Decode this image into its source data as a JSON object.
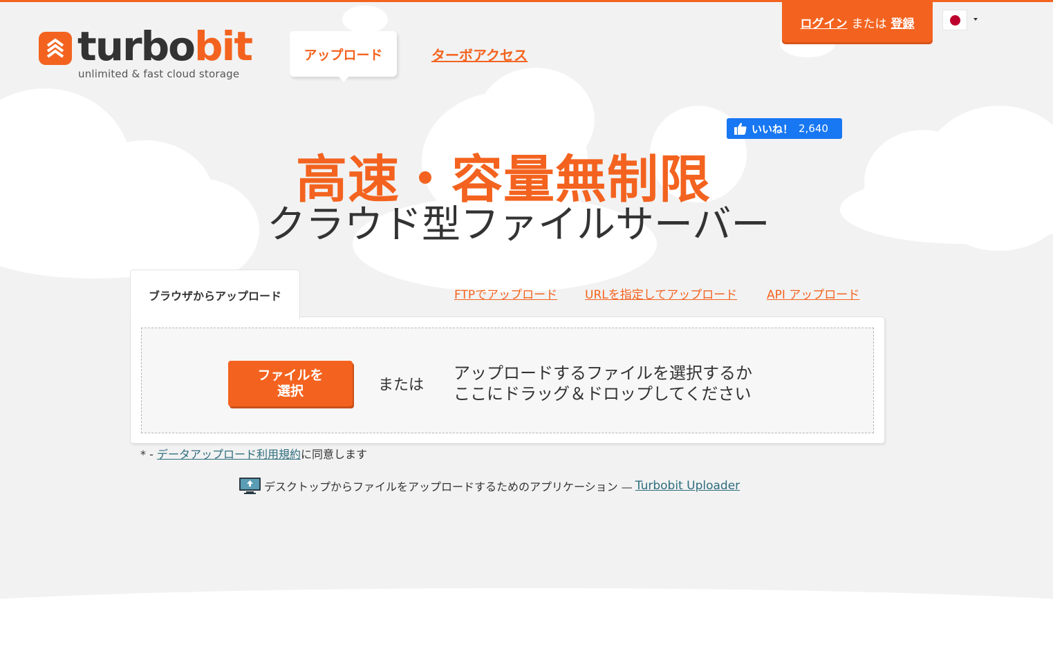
{
  "brand": {
    "name_part1": "turbo",
    "name_part2": "bit",
    "tagline": "unlimited & fast cloud storage",
    "accent_color": "#f3631f"
  },
  "nav": {
    "upload_label": "アップロード",
    "turbo_access_label": "ターボアクセス"
  },
  "auth": {
    "login_label": "ログイン",
    "or_label": "または",
    "register_label": "登録"
  },
  "language": {
    "current": "Japanese flag",
    "icon": "flag-japan-icon"
  },
  "facebook": {
    "like_label": "いいね！",
    "like_count": "2,640"
  },
  "hero": {
    "headline": "高速・容量無制限",
    "subheadline": "クラウド型ファイルサーバー"
  },
  "upload_tabs": {
    "browser": "ブラウザからアップロード",
    "ftp": "FTPでアップロード",
    "url": "URLを指定してアップロード",
    "api": "API アップロード"
  },
  "dropzone": {
    "choose_line1": "ファイルを",
    "choose_line2": "選択",
    "or_label": "または",
    "hint_line1": "アップロードするファイルを選択するか",
    "hint_line2": "ここにドラッグ＆ドロップしてください"
  },
  "terms": {
    "prefix": "* - ",
    "link": "データアップロード利用規約",
    "suffix": "に同意します"
  },
  "app": {
    "text": "デスクトップからファイルをアップロードするためのアプリケーション — ",
    "link": "Turbobit Uploader"
  }
}
